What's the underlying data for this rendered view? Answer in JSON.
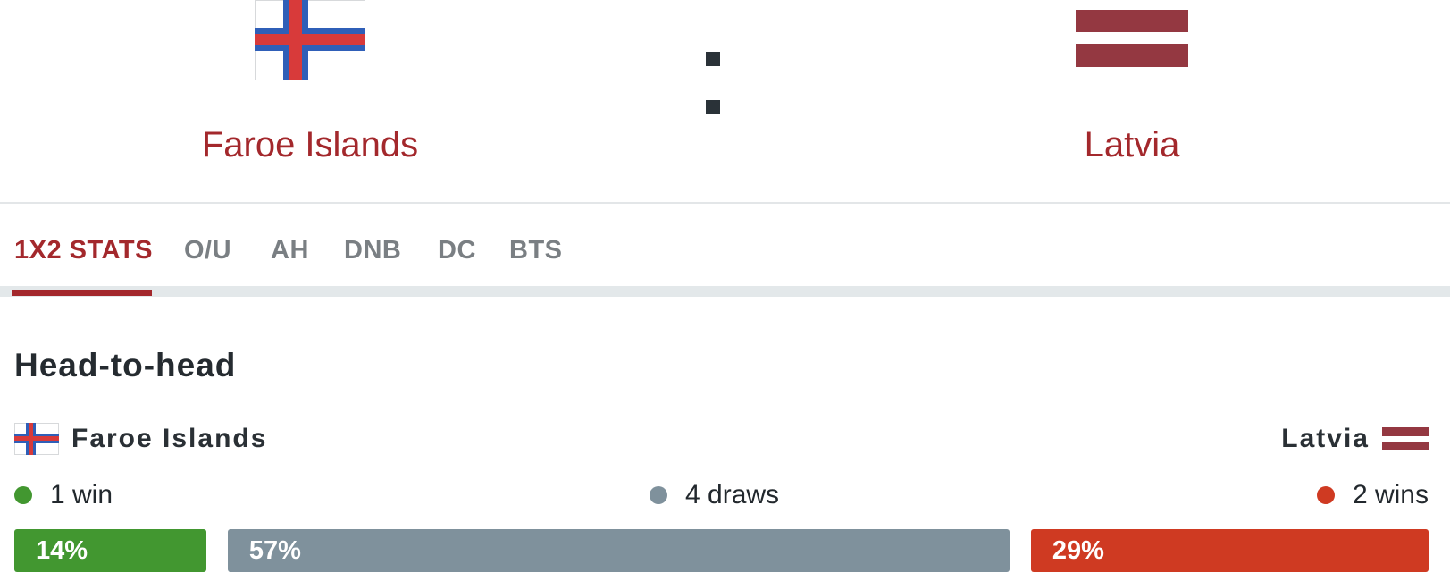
{
  "match": {
    "home_team": "Faroe Islands",
    "away_team": "Latvia",
    "home_flag": "faroe-islands-flag-icon",
    "away_flag": "latvia-flag-icon"
  },
  "tabs": [
    {
      "label": "1X2 STATS",
      "active": true
    },
    {
      "label": "O/U",
      "active": false
    },
    {
      "label": "AH",
      "active": false
    },
    {
      "label": "DNB",
      "active": false
    },
    {
      "label": "DC",
      "active": false
    },
    {
      "label": "BTS",
      "active": false
    }
  ],
  "h2h": {
    "title": "Head-to-head",
    "home_team": "Faroe Islands",
    "away_team": "Latvia",
    "home_wins_text": "1 win",
    "draws_text": "4 draws",
    "away_wins_text": "2 wins",
    "home_pct": 14,
    "draw_pct": 57,
    "away_pct": 29,
    "home_pct_label": "14%",
    "draw_pct_label": "57%",
    "away_pct_label": "29%"
  },
  "colors": {
    "accent": "#a3282c",
    "home": "#429730",
    "draw": "#7f919c",
    "away": "#cf3a22",
    "latvia_flag": "#943841",
    "faroe_blue": "#2f5fb8",
    "faroe_red": "#d83a3a"
  }
}
